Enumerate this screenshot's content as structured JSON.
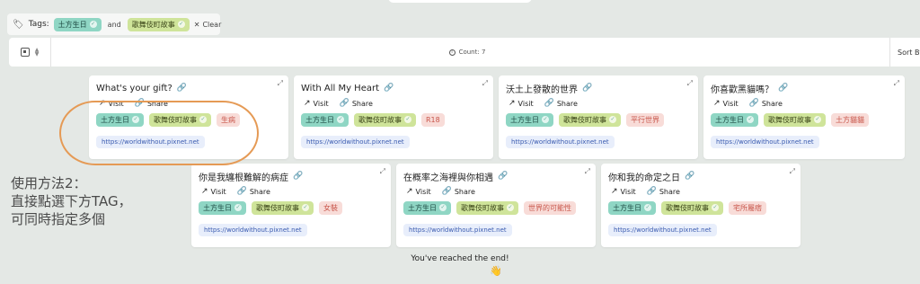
{
  "filter": {
    "tags_label": "Tags:",
    "selected": [
      "土方生日",
      "歌舞伎町故事"
    ],
    "joiner": "and",
    "clear_label": "Clear"
  },
  "toolbar": {
    "count_text": "Count: 7",
    "sort_label": "Sort By"
  },
  "card_actions": {
    "visit": "Visit",
    "share": "Share"
  },
  "cards": [
    {
      "title": "What's your gift?",
      "tags": [
        "土方生日",
        "歌舞伎町故事",
        "生病"
      ],
      "url": "https://worldwithout.pixnet.net"
    },
    {
      "title": "With All My Heart",
      "tags": [
        "土方生日",
        "歌舞伎町故事",
        "R18"
      ],
      "url": "https://worldwithout.pixnet.net"
    },
    {
      "title": "沃土上發散的世界",
      "tags": [
        "土方生日",
        "歌舞伎町故事",
        "平行世界"
      ],
      "url": "https://worldwithout.pixnet.net"
    },
    {
      "title": "你喜歡黑貓嗎？",
      "tags": [
        "土方生日",
        "歌舞伎町故事",
        "土方貓貓"
      ],
      "url": "https://worldwithout.pixnet.net"
    },
    {
      "title": "你是我纏根難解的病症",
      "tags": [
        "土方生日",
        "歌舞伎町故事",
        "女裝"
      ],
      "url": "https://worldwithout.pixnet.net"
    },
    {
      "title": "在概率之海裡與你相遇",
      "tags": [
        "土方生日",
        "歌舞伎町故事",
        "世界的可能性"
      ],
      "url": "https://worldwithout.pixnet.net"
    },
    {
      "title": "你和我的命定之日",
      "tags": [
        "土方生日",
        "歌舞伎町故事",
        "宅所屬痞"
      ],
      "url": "https://worldwithout.pixnet.net"
    }
  ],
  "annotation": {
    "lines": [
      "使用方法2：",
      "直接點選下方TAG，",
      "可同時指定多個"
    ]
  },
  "footer": {
    "end_text": "You've reached the end!",
    "emoji": "👋"
  },
  "colors": {
    "background": "#e4e8e5",
    "chip_teal": "#8fd6c4",
    "chip_lime": "#cfe49a",
    "chip_red": "#f8dcd8",
    "annotation_outline": "#e59a55",
    "url_badge": "#e8eefb"
  },
  "icons": [
    "tag-icon",
    "check-icon",
    "close-icon",
    "grid-view-icon",
    "info-icon",
    "link-icon",
    "external-visit-icon",
    "share-link-icon",
    "expand-icon"
  ]
}
